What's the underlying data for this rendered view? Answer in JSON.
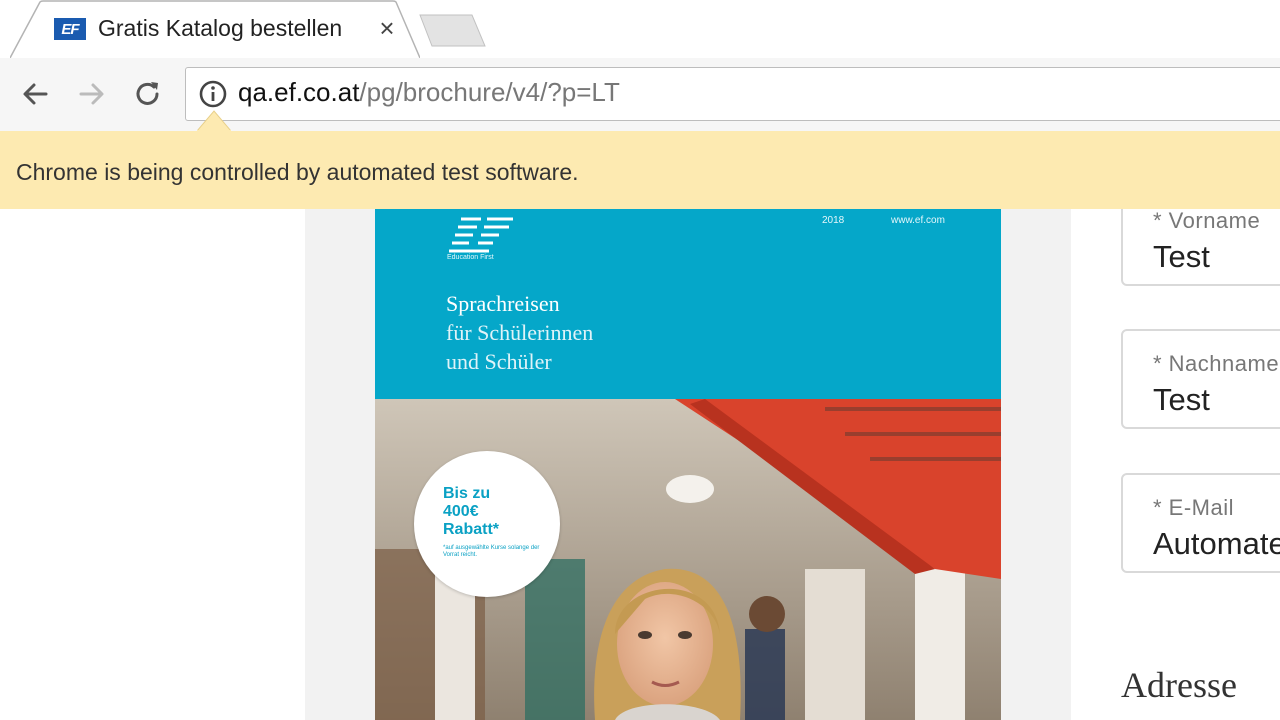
{
  "browser": {
    "tab": {
      "favicon_text": "EF",
      "title": "Gratis Katalog bestellen",
      "close_symbol": "×"
    },
    "toolbar": {
      "back_icon": "arrow-left-icon",
      "forward_icon": "arrow-right-icon",
      "reload_icon": "reload-icon",
      "info_icon": "info-icon",
      "url_host": "qa.ef.co.at",
      "url_path": "/pg/brochure/v4/?p=LT"
    },
    "infobar": {
      "message": "Chrome is being controlled by automated test software."
    }
  },
  "brochure": {
    "logo_subtext": "Education First",
    "year": "2018",
    "website": "www.ef.com",
    "title_line1": "Sprachreisen",
    "title_line2": "für Schülerinnen",
    "title_line3": "und Schüler",
    "badge": {
      "line1": "Bis zu",
      "line2": "400€",
      "line3": "Rabatt*",
      "footnote": "*auf ausgewählte Kurse solange der Vorrat reicht."
    }
  },
  "form": {
    "fields": [
      {
        "label": "* Vorname",
        "value": "Test"
      },
      {
        "label": "* Nachname",
        "value": "Test"
      },
      {
        "label": "* E-Mail",
        "value": "Automate"
      }
    ],
    "section_heading": "Adresse"
  },
  "colors": {
    "brand_blue": "#05a7c9",
    "infobar_bg": "#fdeab1"
  }
}
